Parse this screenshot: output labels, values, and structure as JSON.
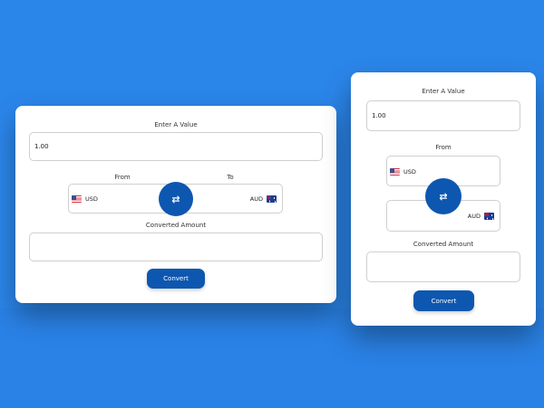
{
  "colors": {
    "background": "#2b86ea",
    "card": "#ffffff",
    "primary": "#0d57b0"
  },
  "wide_card": {
    "enter_label": "Enter A Value",
    "amount_value": "1.00",
    "from_label": "From",
    "to_label": "To",
    "from_currency": "USD",
    "to_currency": "AUD",
    "swap_icon": "⇄",
    "converted_label": "Converted Amount",
    "converted_value": "",
    "convert_button": "Convert"
  },
  "tall_card": {
    "enter_label": "Enter A Value",
    "amount_value": "1.00",
    "from_label": "From",
    "from_currency": "USD",
    "to_currency": "AUD",
    "swap_icon": "⇄",
    "converted_label": "Converted Amount",
    "converted_value": "",
    "convert_button": "Convert"
  },
  "icons": {
    "from_flag": "us-flag-icon",
    "to_flag": "au-flag-icon",
    "swap": "swap-arrows-icon"
  }
}
